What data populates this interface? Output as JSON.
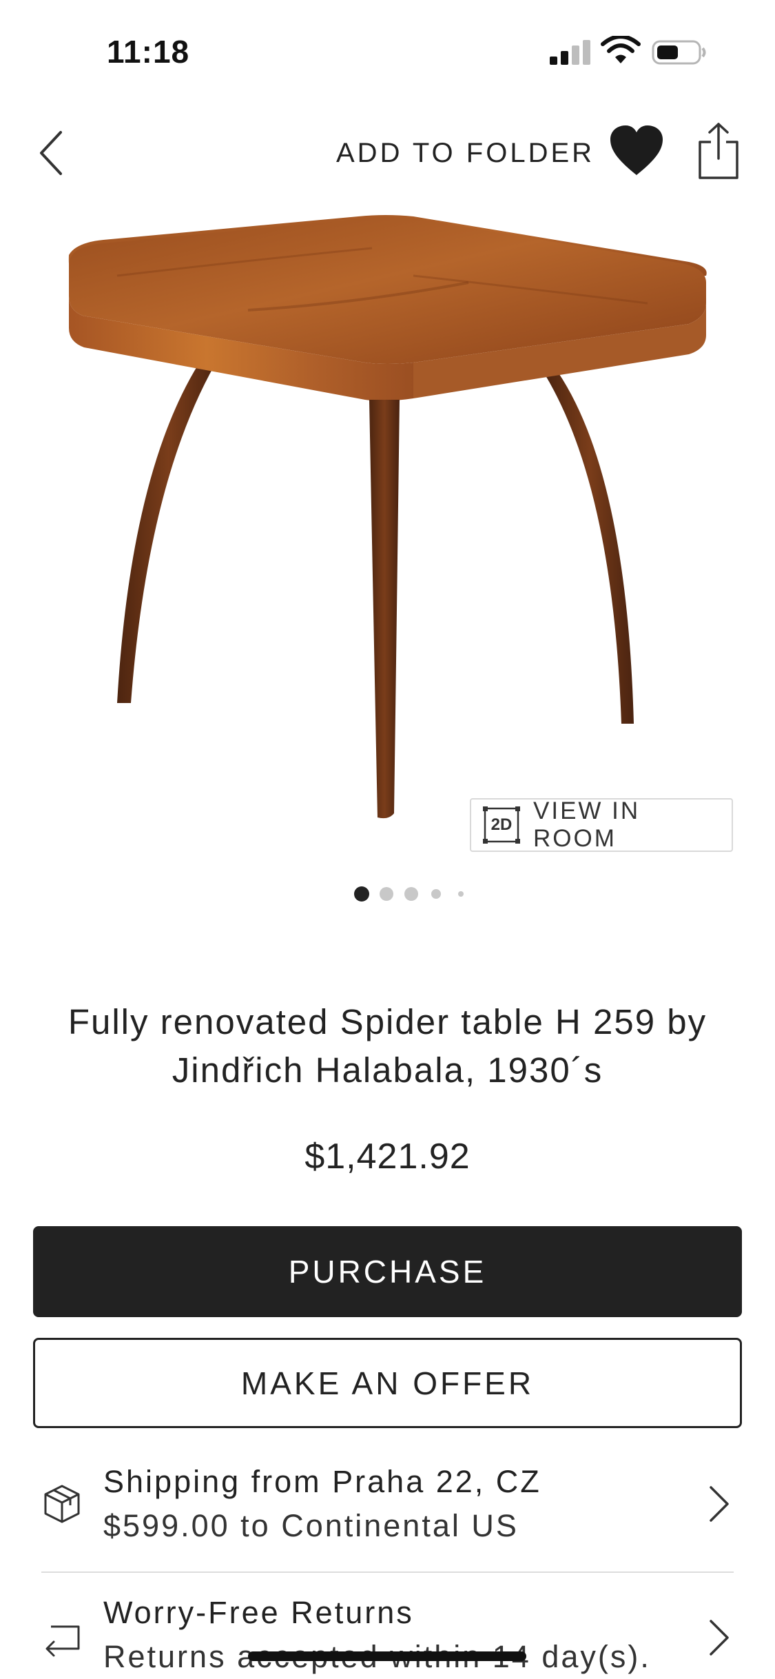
{
  "status_bar": {
    "time": "11:18"
  },
  "nav": {
    "add_to_folder": "ADD TO FOLDER",
    "icons": {
      "back": "chevron-left-icon",
      "favorite": "heart-icon",
      "share": "share-icon"
    }
  },
  "gallery": {
    "view_in_room_badge": "2D",
    "view_in_room": "VIEW IN ROOM",
    "image_count": 5,
    "active_index": 0
  },
  "product": {
    "title": "Fully renovated Spider table H 259 by Jindřich Halabala, 1930´s",
    "price": "$1,421.92"
  },
  "actions": {
    "purchase": "PURCHASE",
    "make_offer": "MAKE AN OFFER"
  },
  "shipping": {
    "title": "Shipping from Praha 22, CZ",
    "subtitle": "$599.00 to Continental US",
    "icon": "package-icon"
  },
  "returns": {
    "title": "Worry-Free Returns",
    "subtitle": "Returns accepted within 14 day(s).",
    "icon": "return-arrow-icon"
  },
  "colors": {
    "primary_button": "#222222",
    "text": "#222222",
    "wood_light": "#b8652a",
    "wood_dark": "#6b3416"
  }
}
